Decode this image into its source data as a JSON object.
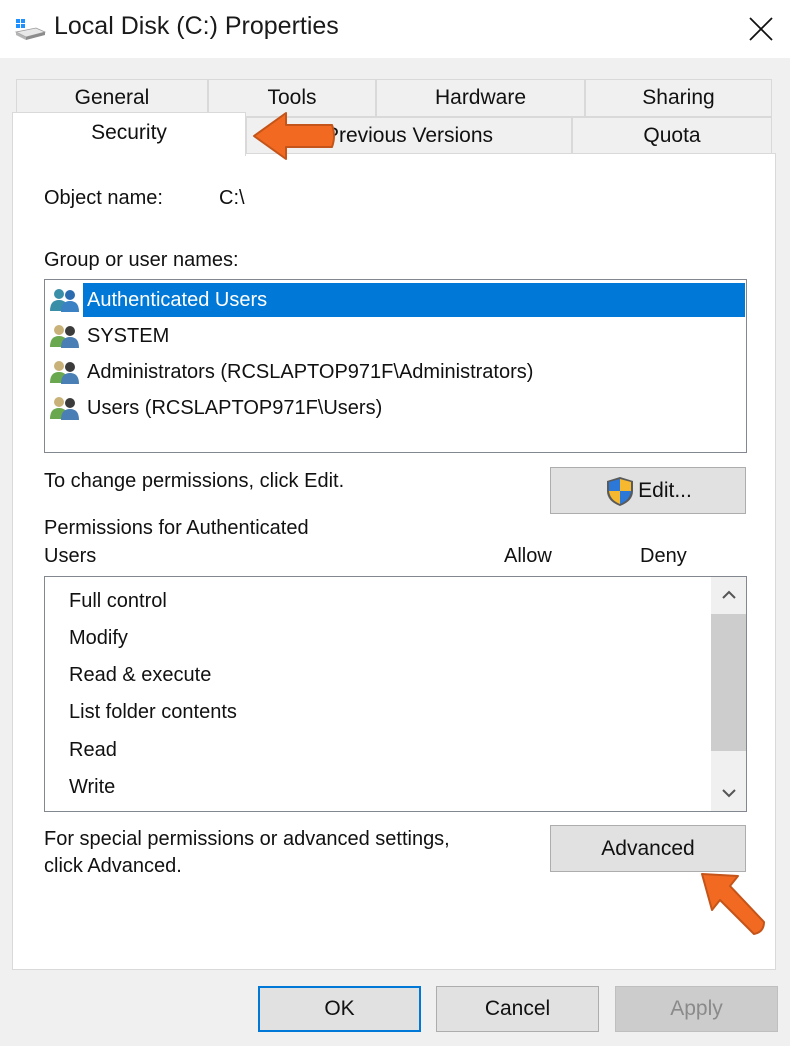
{
  "window": {
    "title": "Local Disk (C:) Properties",
    "icon": "drive-icon",
    "close_icon": "close-icon"
  },
  "tabs": {
    "row1": [
      {
        "label": "General"
      },
      {
        "label": "Tools"
      },
      {
        "label": "Hardware"
      },
      {
        "label": "Sharing"
      }
    ],
    "row2": [
      {
        "label": "Security",
        "active": true
      },
      {
        "label": "Previous Versions"
      },
      {
        "label": "Quota"
      }
    ]
  },
  "security": {
    "object_name_label": "Object name:",
    "object_name_value": "C:\\",
    "group_label": "Group or user names:",
    "users": [
      {
        "name": "Authenticated Users",
        "selected": true,
        "icon": "users-group-icon"
      },
      {
        "name": "SYSTEM",
        "selected": false,
        "icon": "users-group-icon"
      },
      {
        "name": "Administrators (RCSLAPTOP971F\\Administrators)",
        "selected": false,
        "icon": "users-group-icon"
      },
      {
        "name": "Users (RCSLAPTOP971F\\Users)",
        "selected": false,
        "icon": "users-group-icon"
      }
    ],
    "change_text": "To change permissions, click Edit.",
    "edit_button": "Edit...",
    "permissions_for_line1": "Permissions for Authenticated",
    "permissions_for_line2": "Users",
    "allow_header": "Allow",
    "deny_header": "Deny",
    "permissions": [
      {
        "name": "Full control"
      },
      {
        "name": "Modify"
      },
      {
        "name": "Read & execute"
      },
      {
        "name": "List folder contents"
      },
      {
        "name": "Read"
      },
      {
        "name": "Write"
      }
    ],
    "advanced_text_line1": "For special permissions or advanced settings,",
    "advanced_text_line2": "click Advanced.",
    "advanced_button": "Advanced"
  },
  "footer": {
    "ok": "OK",
    "cancel": "Cancel",
    "apply": "Apply",
    "apply_disabled": true
  },
  "colors": {
    "selection": "#0078d7",
    "annotation_arrow": "#f26a21"
  }
}
